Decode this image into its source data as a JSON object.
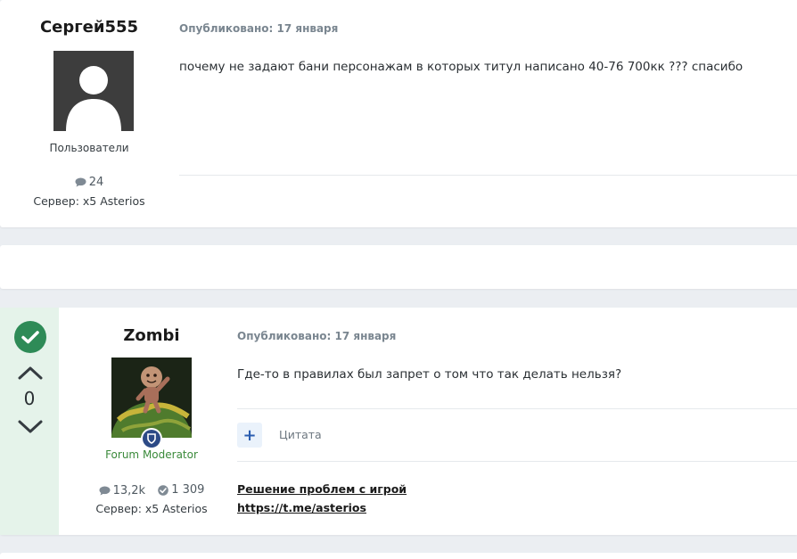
{
  "posts": [
    {
      "author": "Сергей555",
      "group": "Пользователи",
      "posts_count": "24",
      "server": "Сервер: x5 Asterios",
      "published": "Опубликовано: 17 января",
      "content": "почему не задают бани персонажам в которых титул написано 40-76 700кк ??? спасибо"
    },
    {
      "author": "Zombi",
      "group": "Forum Moderator",
      "posts_count": "13,2k",
      "reputation": "1 309",
      "server": "Сервер: x5 Asterios",
      "published": "Опубликовано: 17 января",
      "content": "Где-то в правилах был запрет о том что так делать нельзя?",
      "vote_count": "0",
      "quote_label": "Цитата",
      "signature": {
        "link1": "Решение проблем с игрой",
        "link2": "https://t.me/asterios"
      }
    }
  ],
  "colors": {
    "solved_green": "#2e8b57",
    "moderator_group": "#3a8a3a",
    "vote_bg": "#e5f3ea"
  }
}
